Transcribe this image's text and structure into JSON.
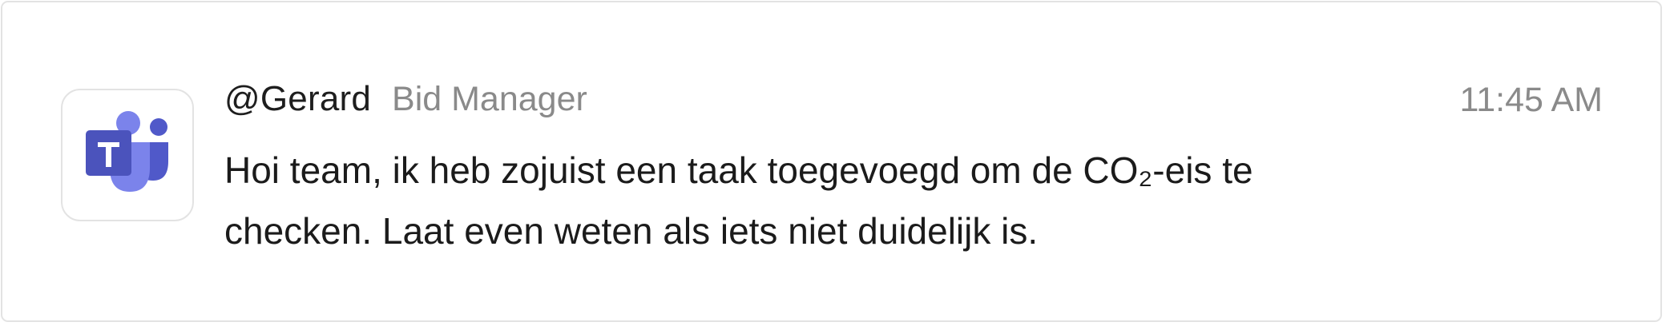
{
  "message": {
    "app_icon": "microsoft-teams-icon",
    "sender": "@Gerard",
    "role": "Bid Manager",
    "timestamp": "11:45 AM",
    "text": "Hoi team, ik heb zojuist een taak toegevoegd om de CO₂-eis te checken. Laat even weten als iets niet duidelijk is."
  },
  "colors": {
    "teams_purple_light": "#7b83eb",
    "teams_purple": "#5059c9",
    "teams_purple_dark": "#4b53bc",
    "border": "#e3e3e3",
    "secondary_text": "#8a8a8a",
    "primary_text": "#1b1b1b"
  }
}
